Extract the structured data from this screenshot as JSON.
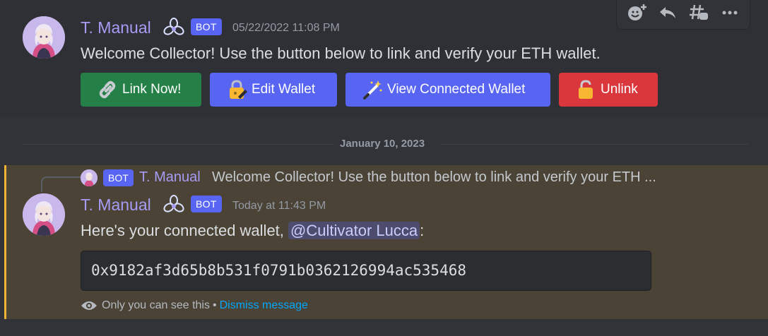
{
  "message1": {
    "username": "T. Manual",
    "bot_tag": "BOT",
    "timestamp": "05/22/2022 11:08 PM",
    "content": "Welcome Collector! Use the button below to link and verify your ETH wallet.",
    "buttons": [
      {
        "label": "Link Now!",
        "icon": "link-icon",
        "color": "#248046"
      },
      {
        "label": "Edit Wallet",
        "icon": "lock-with-pen-icon",
        "color": "#5865f2"
      },
      {
        "label": "View Connected Wallet",
        "icon": "magic-wand-icon",
        "color": "#5865f2"
      },
      {
        "label": "Unlink",
        "icon": "unlocked-padlock-icon",
        "color": "#da373c"
      }
    ]
  },
  "toolbar": {
    "icons": [
      "add-reaction-icon",
      "reply-icon",
      "create-thread-icon",
      "more-icon"
    ]
  },
  "divider": {
    "date": "January 10, 2023"
  },
  "message2": {
    "reply": {
      "bot_tag": "BOT",
      "username": "T. Manual",
      "preview": "Welcome Collector! Use the button below to link and verify your ETH ..."
    },
    "username": "T. Manual",
    "bot_tag": "BOT",
    "timestamp": "Today at 11:43 PM",
    "content_prefix": "Here's your connected wallet, ",
    "mention": "@Cultivator Lucca",
    "content_suffix": ":",
    "wallet_address": "0x9182af3d65b8b531f0791b0362126994ac535468",
    "ephemeral_note": "Only you can see this",
    "separator": "•",
    "dismiss_label": "Dismiss message"
  },
  "colors": {
    "background": "#313338",
    "username": "#a79cf5",
    "bot_tag": "#5865f2",
    "ephemeral_highlight": "#4a4336",
    "ephemeral_border": "#f0b232",
    "link": "#00a8fc"
  }
}
